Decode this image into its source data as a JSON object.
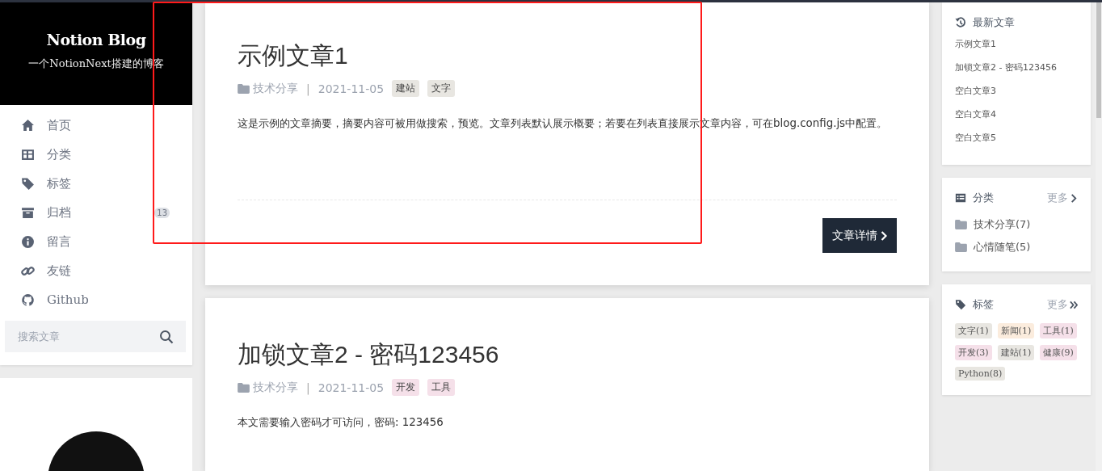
{
  "site": {
    "title": "Notion Blog",
    "subtitle": "一个NotionNext搭建的博客"
  },
  "menu": [
    {
      "label": "首页"
    },
    {
      "label": "分类"
    },
    {
      "label": "标签"
    },
    {
      "label": "归档",
      "count": "13"
    },
    {
      "label": "留言"
    },
    {
      "label": "友链"
    },
    {
      "label": "Github"
    }
  ],
  "search": {
    "placeholder": "搜索文章"
  },
  "posts": [
    {
      "title": "示例文章1",
      "category": "技术分享",
      "separator": "|",
      "date": "2021-11-05",
      "tags": [
        {
          "label": "建站",
          "color": "#e8e6e1"
        },
        {
          "label": "文字",
          "color": "#e8e6e1"
        }
      ],
      "summary": "这是示例的文章摘要，摘要内容可被用做搜索，预览。文章列表默认展示概要；若要在列表直接展示文章内容，可在blog.config.js中配置。",
      "button": "文章详情"
    },
    {
      "title": "加锁文章2 - 密码123456",
      "category": "技术分享",
      "separator": "|",
      "date": "2021-11-05",
      "tags": [
        {
          "label": "开发",
          "color": "#f5e0e9"
        },
        {
          "label": "工具",
          "color": "#f5e0e9"
        }
      ],
      "summary": "本文需要输入密码才可访问，密码: 123456"
    }
  ],
  "latest": {
    "title": "最新文章",
    "items": [
      "示例文章1",
      "加锁文章2 - 密码123456",
      "空白文章3",
      "空白文章4",
      "空白文章5"
    ]
  },
  "categories": {
    "title": "分类",
    "more": "更多",
    "items": [
      "技术分享(7)",
      "心情随笔(5)"
    ]
  },
  "tags": {
    "title": "标签",
    "more": "更多",
    "items": [
      {
        "label": "文字(1)",
        "color": "#e8e6e1"
      },
      {
        "label": "新闻(1)",
        "color": "#fbecdd"
      },
      {
        "label": "工具(1)",
        "color": "#f5e0e9"
      },
      {
        "label": "开发(3)",
        "color": "#f5e0e9"
      },
      {
        "label": "建站(1)",
        "color": "#e8e6e1"
      },
      {
        "label": "健康(9)",
        "color": "#f5e0e9"
      },
      {
        "label": "Python(8)",
        "color": "#e8e6e1"
      }
    ]
  }
}
